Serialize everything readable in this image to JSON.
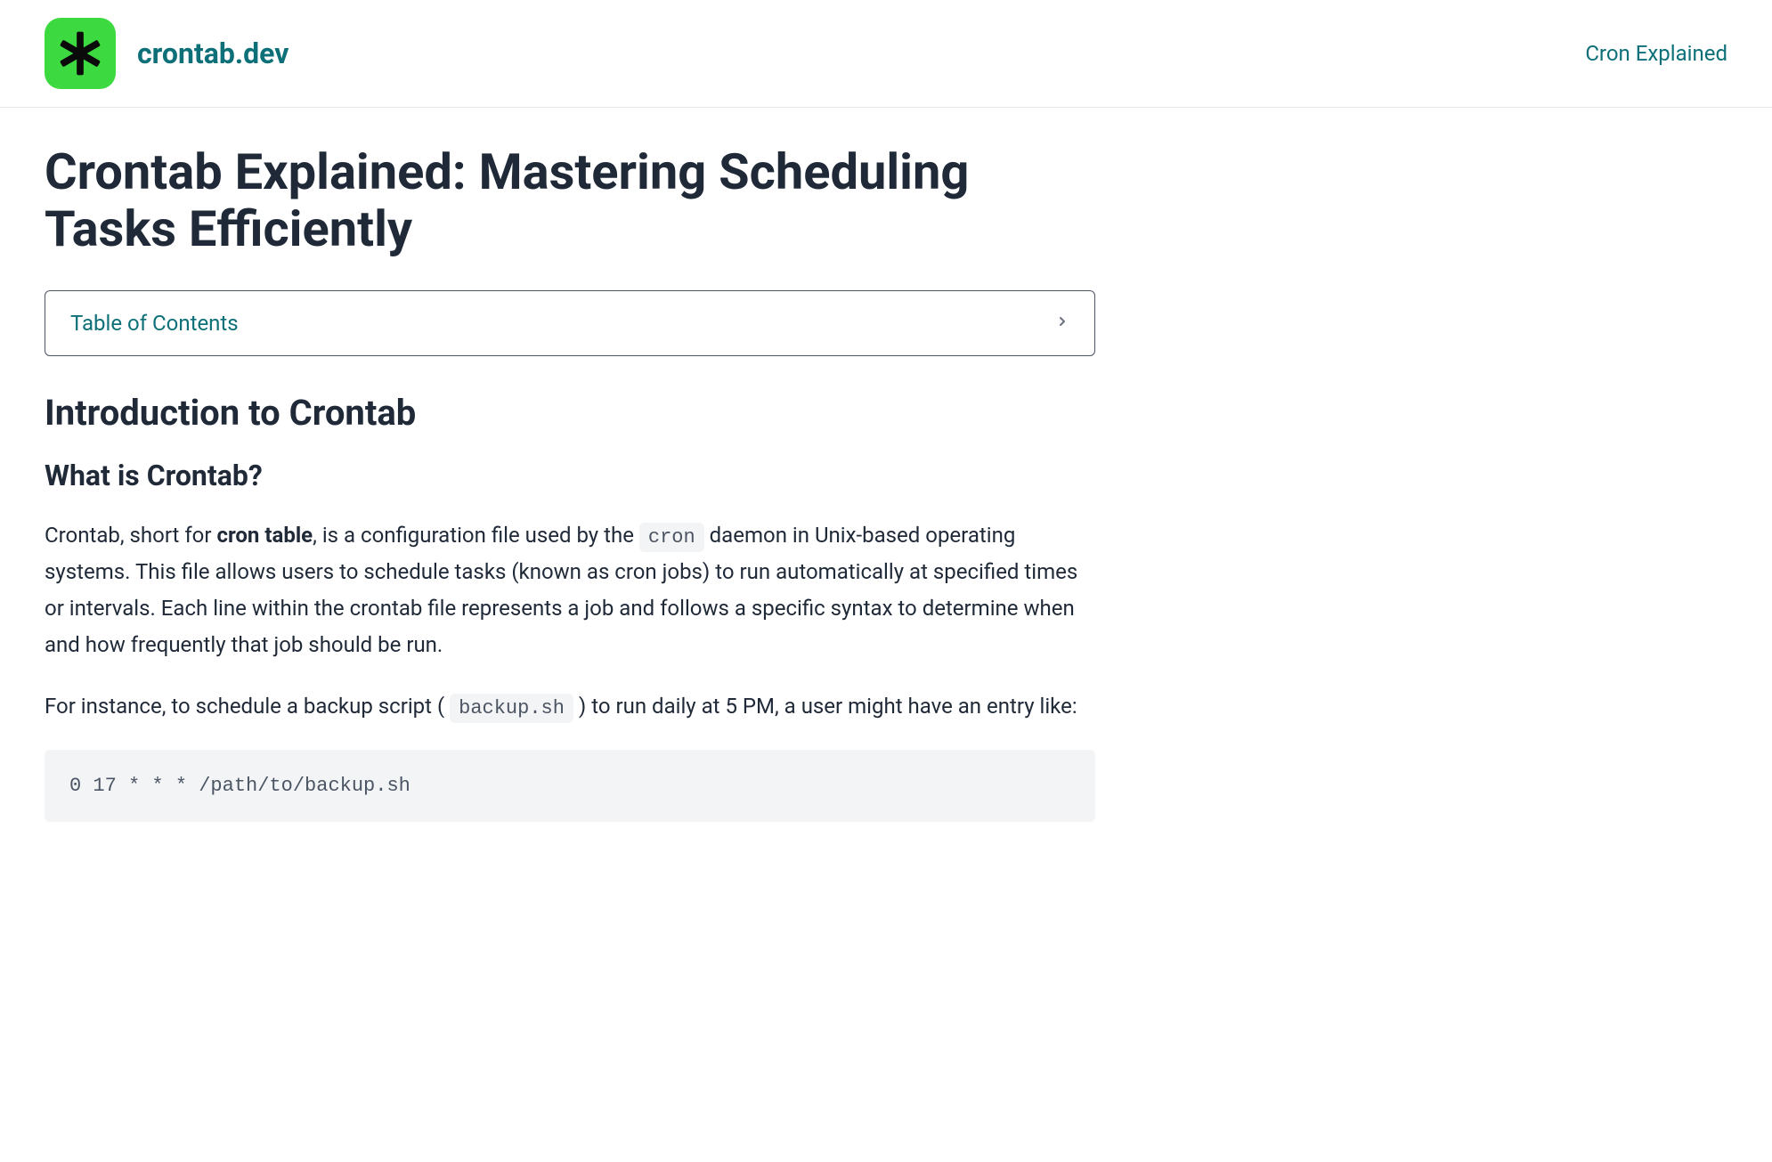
{
  "header": {
    "site_name": "crontab.dev",
    "nav_link": "Cron Explained"
  },
  "page": {
    "title": "Crontab Explained: Mastering Scheduling Tasks Efficiently",
    "toc_label": "Table of Contents"
  },
  "section1": {
    "heading": "Introduction to Crontab",
    "subheading": "What is Crontab?",
    "p1_part1": "Crontab, short for ",
    "p1_bold": "cron table",
    "p1_part2": ", is a configuration file used by the ",
    "p1_code1": "cron",
    "p1_part3": " daemon in Unix-based operating systems. This file allows users to schedule tasks (known as cron jobs) to run automatically at specified times or intervals. Each line within the crontab file represents a job and follows a specific syntax to determine when and how frequently that job should be run.",
    "p2_part1": "For instance, to schedule a backup script ( ",
    "p2_code1": "backup.sh",
    "p2_part2": " ) to run daily at 5 PM, a user might have an entry like:",
    "code_example": "0 17 * * * /path/to/backup.sh"
  }
}
